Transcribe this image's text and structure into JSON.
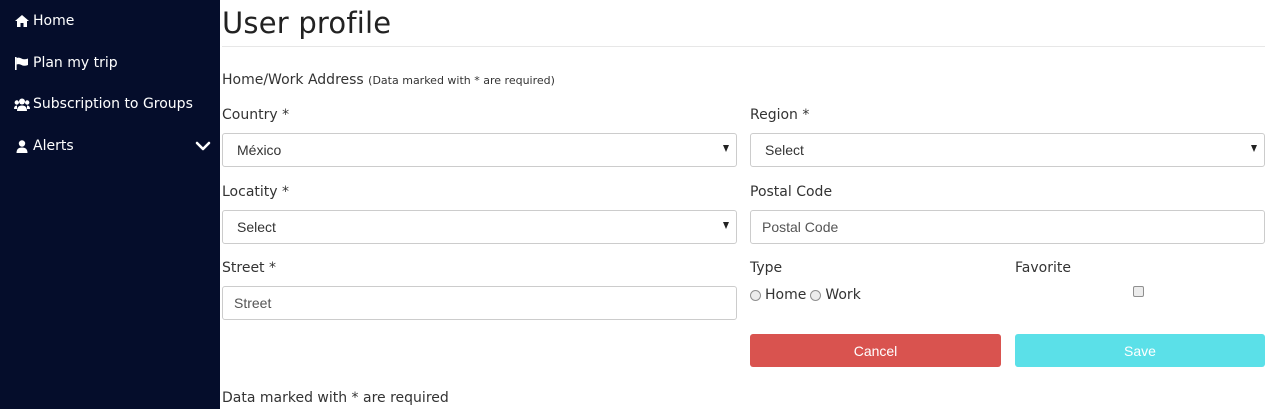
{
  "sidebar": {
    "items": [
      {
        "label": "Home",
        "icon": "home-icon"
      },
      {
        "label": "Plan my trip",
        "icon": "flag-icon"
      },
      {
        "label": "Subscription to Groups",
        "icon": "users-icon"
      },
      {
        "label": "Alerts",
        "icon": "user-icon",
        "expandable": true
      }
    ],
    "background": "#050d2b"
  },
  "page": {
    "title": "User profile",
    "section_title": "Home/Work Address",
    "section_note": "(Data marked with * are required)",
    "footer_note": "Data marked with * are required"
  },
  "form": {
    "country": {
      "label": "Country *",
      "value": "México"
    },
    "region": {
      "label": "Region *",
      "value": "Select"
    },
    "locality": {
      "label": "Locatity *",
      "value": "Select"
    },
    "postal_code": {
      "label": "Postal Code",
      "placeholder": "Postal Code"
    },
    "street": {
      "label": "Street *",
      "placeholder": "Street"
    },
    "type": {
      "label": "Type",
      "options": [
        "Home",
        "Work"
      ]
    },
    "favorite": {
      "label": "Favorite",
      "checked": false
    }
  },
  "buttons": {
    "cancel": "Cancel",
    "save": "Save"
  },
  "colors": {
    "cancel": "#d9534f",
    "save": "#5be0e8"
  }
}
